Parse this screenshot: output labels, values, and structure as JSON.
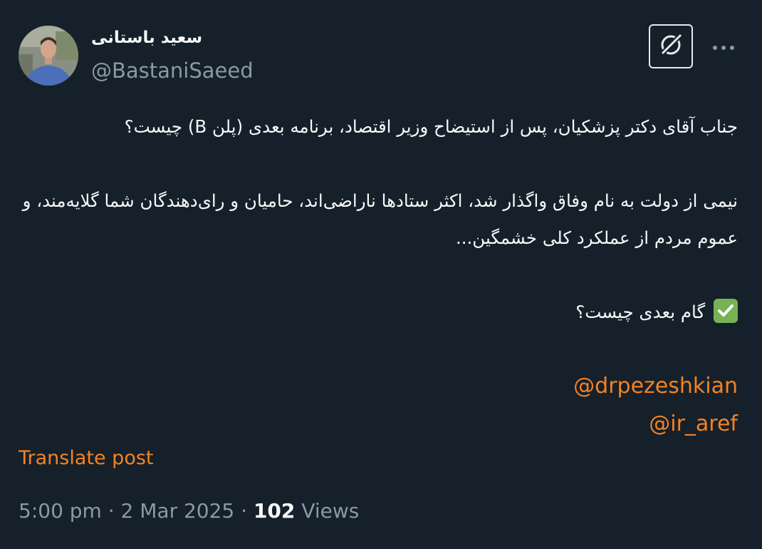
{
  "author": {
    "display_name": "سعید باستانی",
    "handle": "@BastaniSaeed"
  },
  "tweet": {
    "line1": "جناب آقای دکتر پزشکیان، پس از استیضاح وزیر اقتصاد، برنامه بعدی (پلن B) چیست؟",
    "line2": "نیمی از دولت به نام وفاق واگذار شد، اکثر ستادها ناراضی‌اند، حامیان و رای‌دهندگان شما گلایه‌مند، و عموم مردم از عملکرد کلی خشمگین...",
    "line3": "گام بعدی چیست؟",
    "mention1": "@drpezeshkian",
    "mention2": "@ir_aref"
  },
  "translate_label": "Translate post",
  "meta": {
    "time": "5:00 pm",
    "sep1": " · ",
    "date": "2 Mar 2025",
    "sep2": " · ",
    "views_count": "102",
    "views_label": " Views"
  },
  "icons": {
    "grok": "grok-icon",
    "more": "more-icon",
    "check": "check-mark-button-icon"
  },
  "colors": {
    "background": "#15202b",
    "text": "#f7f9f9",
    "secondary": "#8b98a5",
    "accent": "#f58220",
    "check_emoji": "#77b255"
  }
}
